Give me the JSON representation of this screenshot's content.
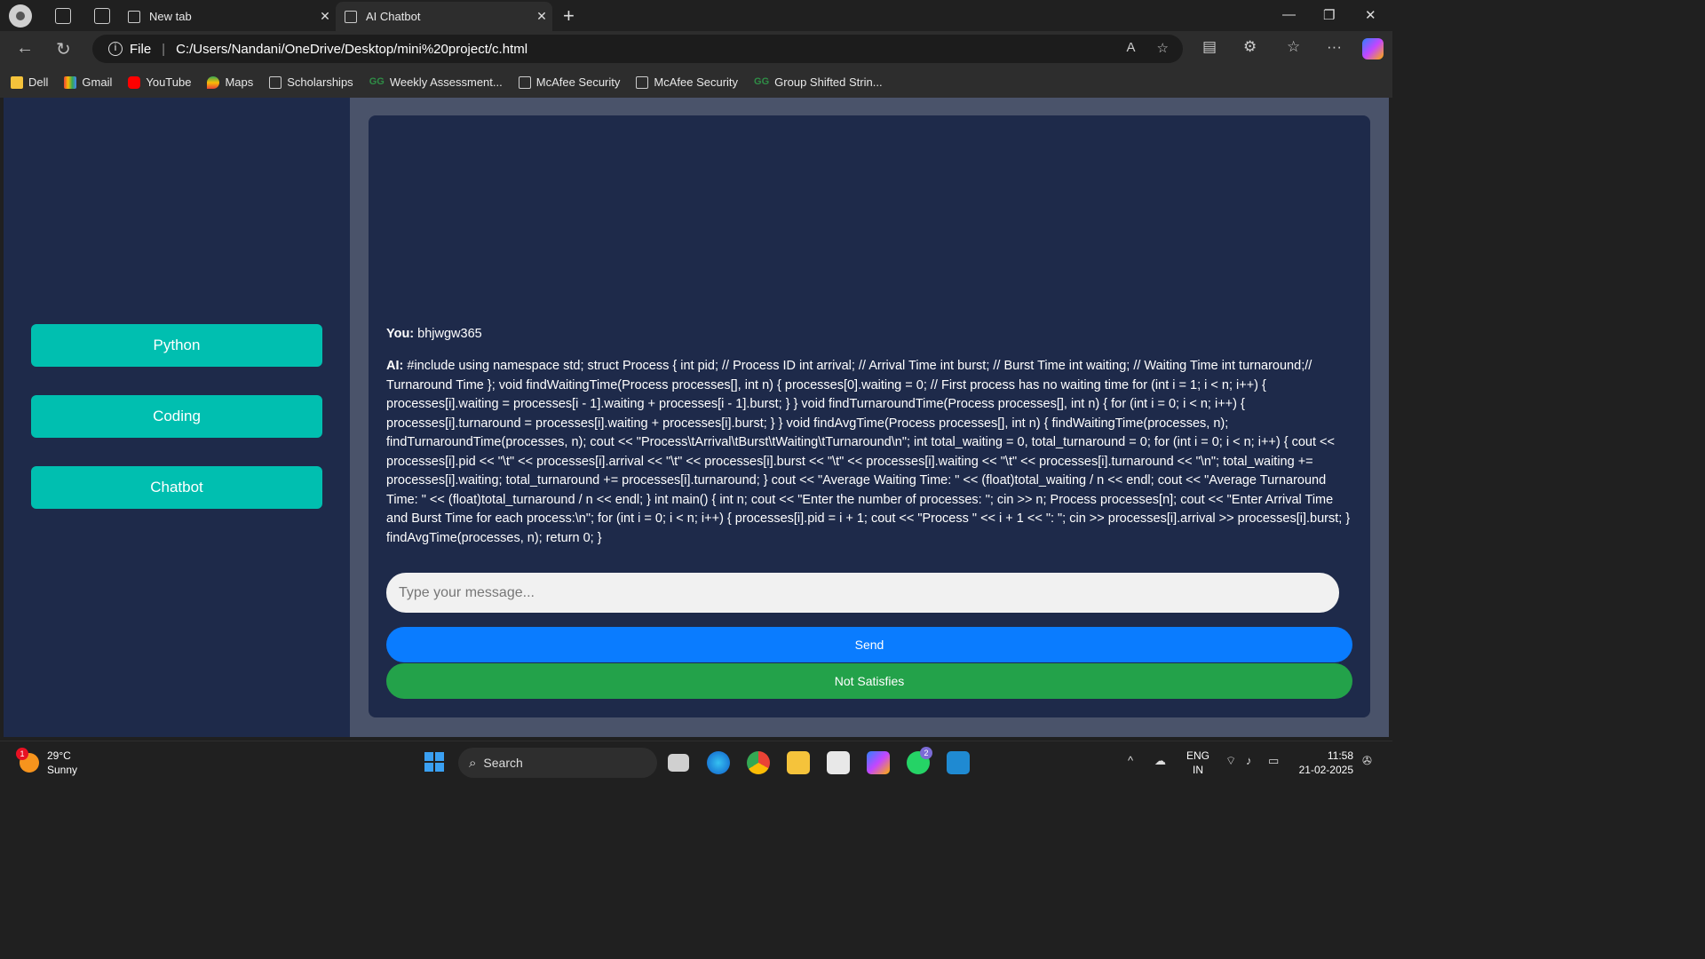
{
  "browser": {
    "tabs": [
      {
        "label": "New tab"
      },
      {
        "label": "AI Chatbot"
      }
    ],
    "address": {
      "scheme_label": "File",
      "url": "C:/Users/Nandani/OneDrive/Desktop/mini%20project/c.html"
    },
    "bookmarks": [
      {
        "label": "Dell",
        "icon": "folder-icon"
      },
      {
        "label": "Gmail",
        "icon": "gmail-icon"
      },
      {
        "label": "YouTube",
        "icon": "youtube-icon"
      },
      {
        "label": "Maps",
        "icon": "maps-icon"
      },
      {
        "label": "Scholarships",
        "icon": "page-icon"
      },
      {
        "label": "Weekly Assessment...",
        "icon": "gfg-icon"
      },
      {
        "label": "McAfee Security",
        "icon": "page-icon"
      },
      {
        "label": "McAfee Security",
        "icon": "page-icon"
      },
      {
        "label": "Group Shifted Strin...",
        "icon": "gfg-icon"
      }
    ]
  },
  "sidebar": {
    "buttons": [
      {
        "label": "Python"
      },
      {
        "label": "Coding"
      },
      {
        "label": "Chatbot"
      }
    ]
  },
  "chat": {
    "messages": [
      {
        "sender": "You:",
        "text": "bhjwgw365"
      },
      {
        "sender": "AI:",
        "text": "#include using namespace std; struct Process { int pid; // Process ID int arrival; // Arrival Time int burst; // Burst Time int waiting; // Waiting Time int turnaround;// Turnaround Time }; void findWaitingTime(Process processes[], int n) { processes[0].waiting = 0; // First process has no waiting time for (int i = 1; i < n; i++) { processes[i].waiting = processes[i - 1].waiting + processes[i - 1].burst; } } void findTurnaroundTime(Process processes[], int n) { for (int i = 0; i < n; i++) { processes[i].turnaround = processes[i].waiting + processes[i].burst; } } void findAvgTime(Process processes[], int n) { findWaitingTime(processes, n); findTurnaroundTime(processes, n); cout << \"Process\\tArrival\\tBurst\\tWaiting\\tTurnaround\\n\"; int total_waiting = 0, total_turnaround = 0; for (int i = 0; i < n; i++) { cout << processes[i].pid << \"\\t\" << processes[i].arrival << \"\\t\" << processes[i].burst << \"\\t\" << processes[i].waiting << \"\\t\" << processes[i].turnaround << \"\\n\"; total_waiting += processes[i].waiting; total_turnaround += processes[i].turnaround; } cout << \"Average Waiting Time: \" << (float)total_waiting / n << endl; cout << \"Average Turnaround Time: \" << (float)total_turnaround / n << endl; } int main() { int n; cout << \"Enter the number of processes: \"; cin >> n; Process processes[n]; cout << \"Enter Arrival Time and Burst Time for each process:\\n\"; for (int i = 0; i < n; i++) { processes[i].pid = i + 1; cout << \"Process \" << i + 1 << \": \"; cin >> processes[i].arrival >> processes[i].burst; } findAvgTime(processes, n); return 0; }"
      }
    ],
    "input_placeholder": "Type your message...",
    "send_label": "Send",
    "not_satisfies_label": "Not Satisfies"
  },
  "taskbar": {
    "weather": {
      "badge": "1",
      "temp": "29°C",
      "condition": "Sunny"
    },
    "search_label": "Search",
    "whatsapp_badge": "2",
    "lang": {
      "line1": "ENG",
      "line2": "IN"
    },
    "clock": {
      "time": "11:58",
      "date": "21-02-2025"
    }
  },
  "colors": {
    "sidebar_bg": "#1e2a4a",
    "accent_teal": "#00bfb0",
    "send_blue": "#0a7cff",
    "not_satisfies_green": "#23a24a"
  }
}
